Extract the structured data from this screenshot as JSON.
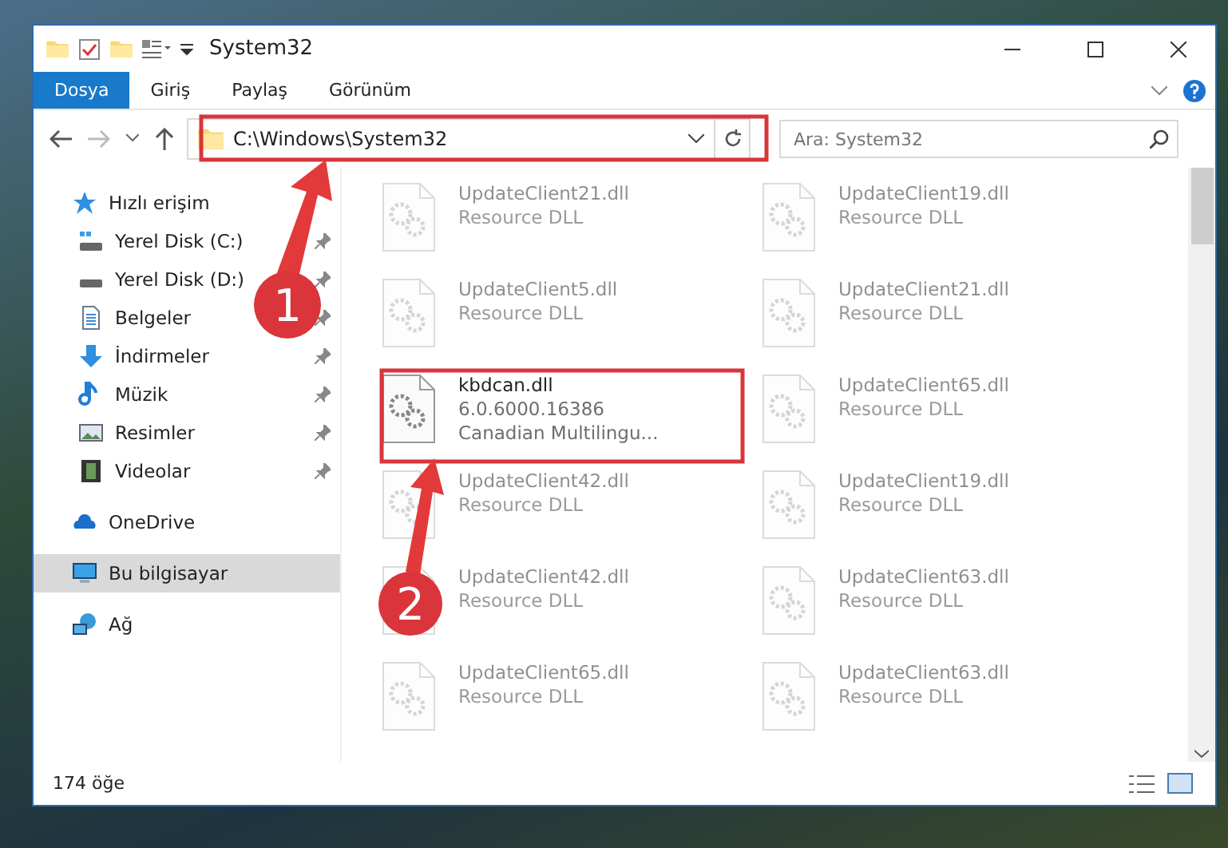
{
  "window": {
    "title": "System32"
  },
  "ribbon_tabs": [
    {
      "label": "Dosya",
      "selected": true
    },
    {
      "label": "Giriş",
      "selected": false
    },
    {
      "label": "Paylaş",
      "selected": false
    },
    {
      "label": "Görünüm",
      "selected": false
    }
  ],
  "address_bar": {
    "path": "C:\\Windows\\System32"
  },
  "search": {
    "placeholder": "Ara: System32"
  },
  "sidebar": {
    "items": [
      {
        "label": "Hızlı erişim",
        "kind": "star",
        "selected": false,
        "children": [
          {
            "label": "Yerel Disk (C:)",
            "kind": "drive-c",
            "pinned": true,
            "selected": false
          },
          {
            "label": "Yerel Disk (D:)",
            "kind": "drive",
            "pinned": true,
            "selected": false
          },
          {
            "label": "Belgeler",
            "kind": "document",
            "pinned": true,
            "selected": false
          },
          {
            "label": "İndirmeler",
            "kind": "download",
            "pinned": true,
            "selected": false
          },
          {
            "label": "Müzik",
            "kind": "music",
            "pinned": true,
            "selected": false
          },
          {
            "label": "Resimler",
            "kind": "pictures",
            "pinned": true,
            "selected": false
          },
          {
            "label": "Videolar",
            "kind": "video",
            "pinned": true,
            "selected": false
          }
        ]
      },
      {
        "label": "OneDrive",
        "kind": "cloud",
        "selected": false
      },
      {
        "label": "Bu bilgisayar",
        "kind": "computer",
        "selected": true
      },
      {
        "label": "Ağ",
        "kind": "network",
        "selected": false
      }
    ]
  },
  "files": [
    {
      "name": "UpdateClient21.dll",
      "lines": [
        "Resource DLL"
      ],
      "faded": true
    },
    {
      "name": "UpdateClient19.dll",
      "lines": [
        "Resource DLL"
      ],
      "faded": true
    },
    {
      "name": "UpdateClient5.dll",
      "lines": [
        "Resource DLL"
      ],
      "faded": true
    },
    {
      "name": "UpdateClient21.dll",
      "lines": [
        "Resource DLL"
      ],
      "faded": true
    },
    {
      "name": "kbdcan.dll",
      "lines": [
        "6.0.6000.16386",
        "Canadian Multilingu..."
      ],
      "faded": false
    },
    {
      "name": "UpdateClient65.dll",
      "lines": [
        "Resource DLL"
      ],
      "faded": true
    },
    {
      "name": "UpdateClient42.dll",
      "lines": [
        "Resource DLL"
      ],
      "faded": true
    },
    {
      "name": "UpdateClient19.dll",
      "lines": [
        "Resource DLL"
      ],
      "faded": true
    },
    {
      "name": "UpdateClient42.dll",
      "lines": [
        "Resource DLL"
      ],
      "faded": true
    },
    {
      "name": "UpdateClient63.dll",
      "lines": [
        "Resource DLL"
      ],
      "faded": true
    },
    {
      "name": "UpdateClient65.dll",
      "lines": [
        "Resource DLL"
      ],
      "faded": true
    },
    {
      "name": "UpdateClient63.dll",
      "lines": [
        "Resource DLL"
      ],
      "faded": true
    }
  ],
  "status_bar": {
    "count": "174 öğe"
  },
  "annotations": [
    {
      "number": "1"
    },
    {
      "number": "2"
    }
  ]
}
